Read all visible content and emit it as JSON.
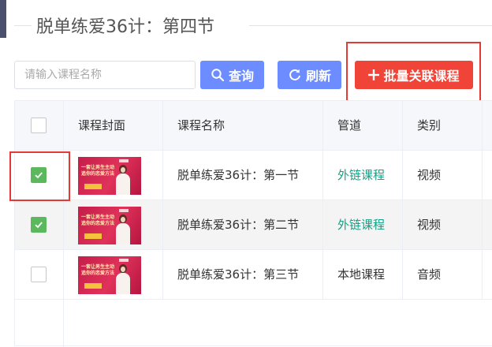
{
  "page": {
    "title": "脱单练爱36计：第四节"
  },
  "toolbar": {
    "search_placeholder": "请输入课程名称",
    "search_value": "",
    "query_label": "查询",
    "refresh_label": "刷新",
    "batch_label": "批量关联课程"
  },
  "table": {
    "headers": {
      "cover": "课程封面",
      "name": "课程名称",
      "channel": "管道",
      "category": "类别"
    },
    "rows": [
      {
        "checked": true,
        "name": "脱单练爱36计：第一节",
        "channel": "外链课程",
        "category": "视频",
        "cover_text": "一套让男生主动追你的恋爱方法"
      },
      {
        "checked": true,
        "name": "脱单练爱36计：第二节",
        "channel": "外链课程",
        "category": "视频",
        "cover_text": "一套让男生主动追你的恋爱方法"
      },
      {
        "checked": false,
        "name": "脱单练爱36计：第三节",
        "channel": "本地课程",
        "category": "音频",
        "cover_text": "一套让男生主动追你的恋爱方法"
      }
    ]
  },
  "colors": {
    "primary": "#6c8cff",
    "danger": "#f04438",
    "success": "#5cb85c",
    "link_green": "#16a085",
    "annotation_red": "#e53935"
  },
  "icons": {
    "search": "search-icon",
    "refresh": "refresh-icon",
    "plus": "plus-icon",
    "check": "check-icon"
  }
}
